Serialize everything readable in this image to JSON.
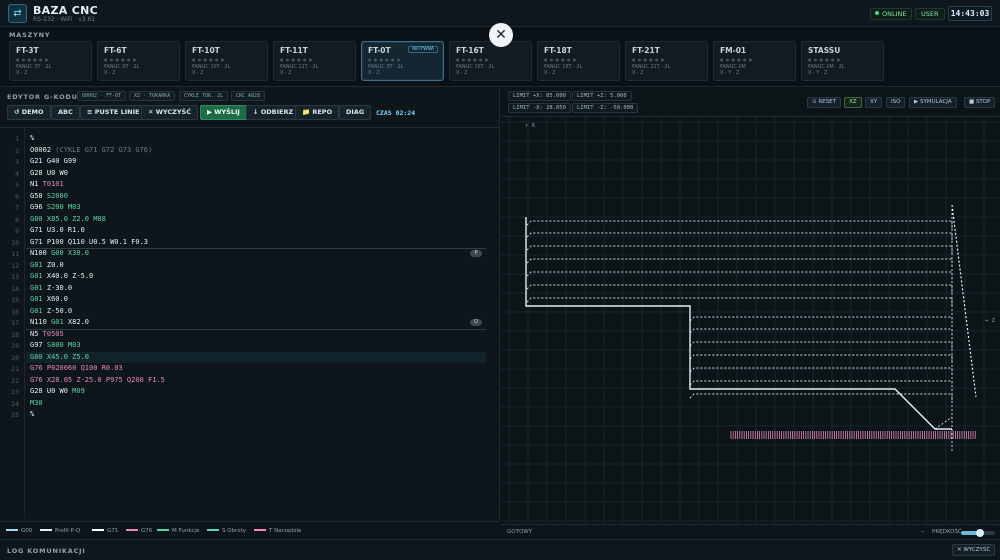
{
  "header": {
    "logo_icon": "⇄",
    "title": "BAZA CNC",
    "subtitle": "RS-232 · WiFi · v3.61",
    "status_online": "ONLINE",
    "user": "USER",
    "clock": "14:43:03"
  },
  "machines": {
    "label": "MASZYNY",
    "items": [
      {
        "name": "FT-3T",
        "ctrl": "FANUC 3T · 2L",
        "sub": "X · Z"
      },
      {
        "name": "FT-6T",
        "ctrl": "FANUC 6T · 2L",
        "sub": "X · Z"
      },
      {
        "name": "FT-10T",
        "ctrl": "FANUC 10T · 2L",
        "sub": "X · Z"
      },
      {
        "name": "FT-11T",
        "ctrl": "FANUC 11T · 2L",
        "sub": "X · Z"
      },
      {
        "name": "FT-0T",
        "ctrl": "FANUC 0T · 2L",
        "sub": "X · Z",
        "badge": "AKTYWNA"
      },
      {
        "name": "FT-16T",
        "ctrl": "FANUC 16T · 2L",
        "sub": "X · Z"
      },
      {
        "name": "FT-18T",
        "ctrl": "FANUC 18T · 2L",
        "sub": "X · Z"
      },
      {
        "name": "FT-21T",
        "ctrl": "FANUC 21T · 2L",
        "sub": "X · Z"
      },
      {
        "name": "FM-01",
        "ctrl": "FANUC 0M",
        "sub": "X · Y · Z"
      },
      {
        "name": "STASSU",
        "ctrl": "FANUC 0M · 2L",
        "sub": "X · Y · Z"
      }
    ],
    "close_icon": "✕"
  },
  "editor": {
    "title": "EDYTOR G-KODU",
    "chips": [
      "O0002 · FT-0T",
      "XZ · TOKARKA",
      "CYKLE TOK. 2L",
      "CRC A828"
    ],
    "buttons": {
      "demo": "↺ DEMO",
      "abc": "ABC",
      "empty": "≡ PUSTE LINIE",
      "clear": "✕ WYCZYŚĆ",
      "send": "▶ WYŚLIJ",
      "receive": "↓ ODBIERZ",
      "repo": "📁 REPO",
      "diag": "DIAG"
    },
    "time": "CZAS 02:24",
    "lines": [
      [
        [
          "w",
          "%"
        ]
      ],
      [
        [
          "w",
          "O0002 "
        ],
        [
          "c",
          "(CYKLE G71 G72 G73 G76)"
        ]
      ],
      [
        [
          "w",
          "G21 G40 G99"
        ]
      ],
      [
        [
          "w",
          "G28 U0 W0"
        ]
      ],
      [
        [
          "w",
          "N1 "
        ],
        [
          "p",
          "T0101"
        ]
      ],
      [
        [
          "w",
          "G50 "
        ],
        [
          "g",
          "S2000"
        ]
      ],
      [
        [
          "w",
          "G96 "
        ],
        [
          "g",
          "S200 M03"
        ]
      ],
      [
        [
          "g",
          "G00 X85.0 Z2.0 M08"
        ]
      ],
      [
        [
          "w",
          "G71 U3.0 R1.0"
        ]
      ],
      [
        [
          "w",
          "G71 P100 Q110 U0.5 W0.1 F0.3"
        ]
      ],
      [
        [
          "w",
          "N100 "
        ],
        [
          "g",
          "G00 X30.0"
        ]
      ],
      [
        [
          "g",
          "G01 "
        ],
        [
          "w",
          "Z0.0"
        ]
      ],
      [
        [
          "g",
          "G01 "
        ],
        [
          "w",
          "X40.0 Z-5.0"
        ]
      ],
      [
        [
          "g",
          "G01 "
        ],
        [
          "w",
          "Z-30.0"
        ]
      ],
      [
        [
          "g",
          "G01 "
        ],
        [
          "w",
          "X60.0"
        ]
      ],
      [
        [
          "g",
          "G01 "
        ],
        [
          "w",
          "Z-50.0"
        ]
      ],
      [
        [
          "w",
          "N110 "
        ],
        [
          "g",
          "G01 "
        ],
        [
          "w",
          "X82.0"
        ]
      ],
      [
        [
          "w",
          "N5 "
        ],
        [
          "p",
          "T0505"
        ]
      ],
      [
        [
          "w",
          "G97 "
        ],
        [
          "g",
          "S800 M03"
        ]
      ],
      [
        [
          "g",
          "G00 X45.0 Z5.0"
        ]
      ],
      [
        [
          "p",
          "G76 P020060 Q100 R0.03"
        ]
      ],
      [
        [
          "p",
          "G76 X28.05 Z-25.0 P975 Q200 F1.5"
        ]
      ],
      [
        [
          "w",
          "G28 U0 W0 "
        ],
        [
          "g",
          "M09"
        ]
      ],
      [
        [
          "g",
          "M30"
        ]
      ],
      [
        [
          "w",
          "%"
        ]
      ]
    ],
    "fold_badges": [
      "P",
      "Q"
    ],
    "legend": [
      {
        "label": "G00",
        "color": "#9fd7ff"
      },
      {
        "label": "Profil P-Q",
        "color": "#e8eef1"
      },
      {
        "label": "G71",
        "color": "#ffffff"
      },
      {
        "label": "G76",
        "color": "#e589b6"
      },
      {
        "label": "M Funkcje",
        "color": "#5fd3a0"
      },
      {
        "label": "S Obroty",
        "color": "#5fd3c0"
      },
      {
        "label": "T Narzędzie",
        "color": "#f28bb8"
      }
    ]
  },
  "preview": {
    "limits": [
      "LIMIT +X: 85.000",
      "LIMIT +Z: 5.000",
      "LIMIT -X: 28.050",
      "LIMIT -Z: -50.000"
    ],
    "buttons": {
      "reset": "⊙ RESET",
      "xz": "XZ",
      "xy": "XY",
      "iso": "ISO",
      "sim": "▶ SYMULACJA",
      "stop": "■ STOP"
    },
    "axis_x": "↑ X",
    "axis_z": "→ Z",
    "ready": "GOTOWY",
    "minus": "–",
    "speed_label": "PRĘDKOŚĆ",
    "speed": 0.55
  },
  "log": {
    "label": "LOG KOMUNIKACJI",
    "clear": "✕ WYCZYŚĆ"
  }
}
